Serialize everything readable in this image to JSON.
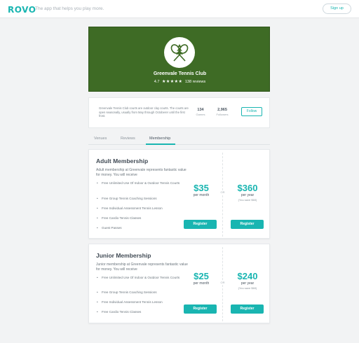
{
  "header": {
    "logo": "ROVO",
    "tagline": "The app that helps you play more.",
    "signup_label": "Sign up"
  },
  "club": {
    "name": "Greenvale Tennis Club",
    "rating": "4.7",
    "stars": "★★★★★",
    "reviews": "138 reviews",
    "description": "Greenvale Tennis Club courts are outdoor clay courts. The courts are open seasonally, usually from May through Octoberer until the first frost.",
    "stats": [
      {
        "value": "134",
        "label": "Games"
      },
      {
        "value": "2,965",
        "label": "Followers"
      }
    ],
    "follow_label": "Follow",
    "hero_color": "#3e6b25"
  },
  "tabs": [
    {
      "label": "Venues"
    },
    {
      "label": "Reviews"
    },
    {
      "label": "Membership"
    }
  ],
  "accent_color": "#19b5b1",
  "memberships": [
    {
      "title": "Adult Membership",
      "description": "Adult membership at Greenvale represents fantastic value for money. You will receive",
      "features": [
        "Free Unlimited Use Of Indoor & Outdoor Tennis Courts",
        "Free Group Tennis Coaching Sessions",
        "Free Individual Assessment Tennis Lesson",
        "Free Cardio Tennis Classes",
        "Guest Passes"
      ],
      "or_label": "OR",
      "monthly": {
        "amount": "$35",
        "period": "per month",
        "button": "Register"
      },
      "yearly": {
        "amount": "$360",
        "period": "per year",
        "saving": "(You save $60)",
        "button": "Register"
      }
    },
    {
      "title": "Junior Membership",
      "description": "Junior membership at Greenvale represents fantastic value for money. You will receive",
      "features": [
        "Free Unlimited Use Of Indoor & Outdoor Tennis Courts",
        "Free Group Tennis Coaching Sessions",
        "Free Individual Assessment Tennis Lesson",
        "Free Cardio Tennis Classes"
      ],
      "or_label": "OR",
      "monthly": {
        "amount": "$25",
        "period": "per month",
        "button": "Register"
      },
      "yearly": {
        "amount": "$240",
        "period": "per year",
        "saving": "(You save $60)",
        "button": "Register"
      }
    }
  ]
}
